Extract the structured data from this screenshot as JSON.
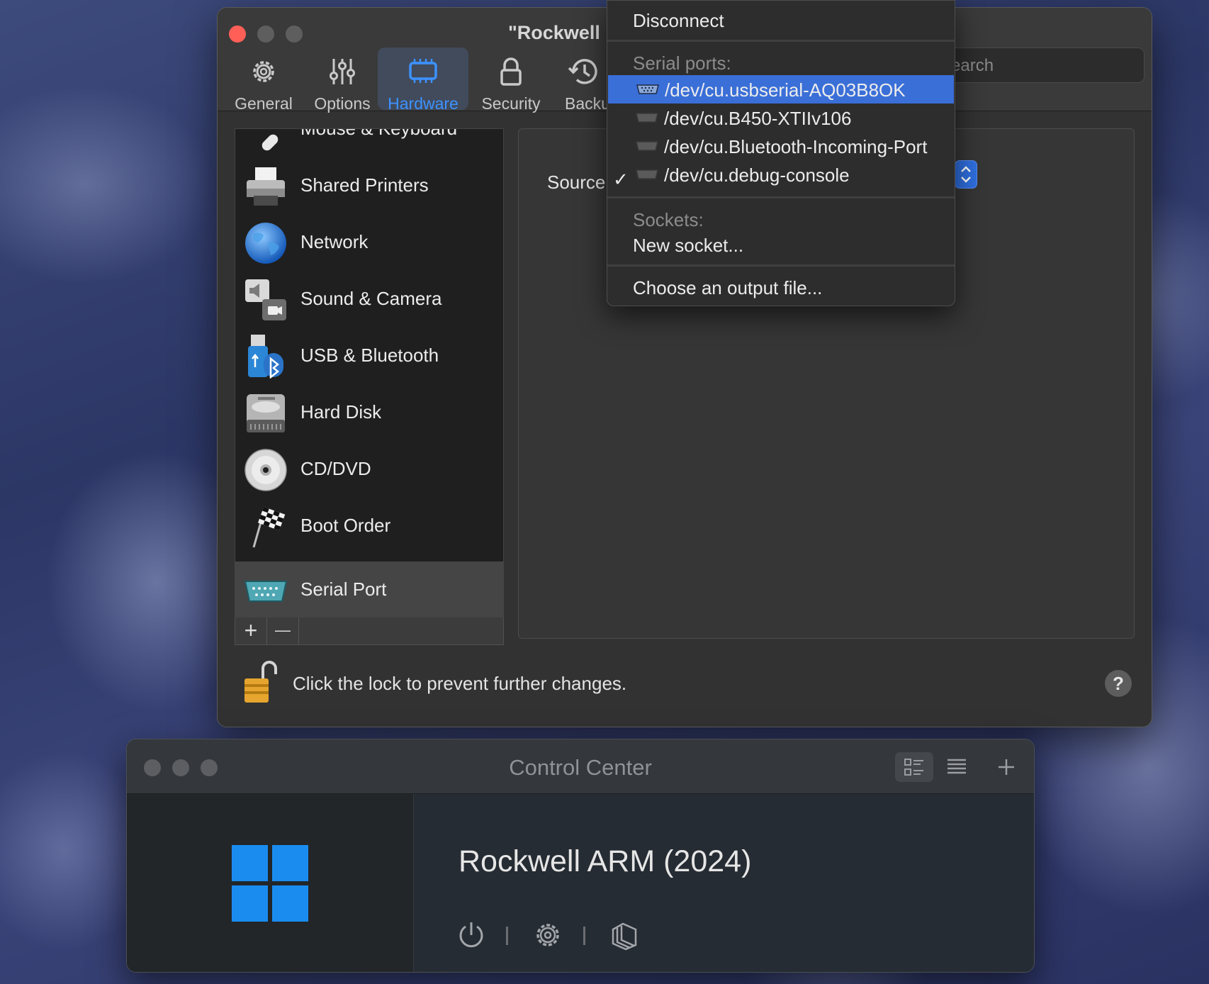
{
  "settings_window": {
    "title": "\"Rockwell",
    "toolbar": [
      {
        "label": "General",
        "icon": "gear-icon"
      },
      {
        "label": "Options",
        "icon": "sliders-icon"
      },
      {
        "label": "Hardware",
        "icon": "chip-icon",
        "active": true
      },
      {
        "label": "Security",
        "icon": "lock-icon"
      },
      {
        "label": "Backu",
        "icon": "clock-icon"
      }
    ],
    "search_placeholder": "Search",
    "sidebar": {
      "items": [
        {
          "label": "Mouse & Keyboard",
          "icon": "mouse-icon"
        },
        {
          "label": "Shared Printers",
          "icon": "printer-icon"
        },
        {
          "label": "Network",
          "icon": "globe-icon"
        },
        {
          "label": "Sound & Camera",
          "icon": "speaker-camera-icon"
        },
        {
          "label": "USB & Bluetooth",
          "icon": "usb-bluetooth-icon"
        },
        {
          "label": "Hard Disk",
          "icon": "hard-disk-icon"
        },
        {
          "label": "CD/DVD",
          "icon": "cd-icon"
        },
        {
          "label": "Boot Order",
          "icon": "checkered-flag-icon"
        },
        {
          "label": "Serial Port",
          "icon": "serial-port-icon",
          "selected": true
        }
      ],
      "add_label": "+",
      "remove_label": "—"
    },
    "panel": {
      "source_label": "Source"
    },
    "lock_text": "Click the lock to prevent further changes.",
    "help_label": "?"
  },
  "dropdown": {
    "disconnect": "Disconnect",
    "serial_header": "Serial ports:",
    "ports": [
      {
        "label": "/dev/cu.usbserial-AQ03B8OK",
        "highlighted": true
      },
      {
        "label": "/dev/cu.B450-XTIIv106"
      },
      {
        "label": "/dev/cu.Bluetooth-Incoming-Port"
      },
      {
        "label": "/dev/cu.debug-console",
        "checked": true
      }
    ],
    "check_mark": "✓",
    "sockets_header": "Sockets:",
    "new_socket": "New socket...",
    "output_file": "Choose an output file..."
  },
  "control_center": {
    "title": "Control Center",
    "vm_name": "Rockwell ARM (2024)"
  },
  "colors": {
    "accent": "#3d92ff",
    "highlight": "#3a6fd8",
    "close": "#ff5f57",
    "windows_blue": "#1a8cf0"
  }
}
